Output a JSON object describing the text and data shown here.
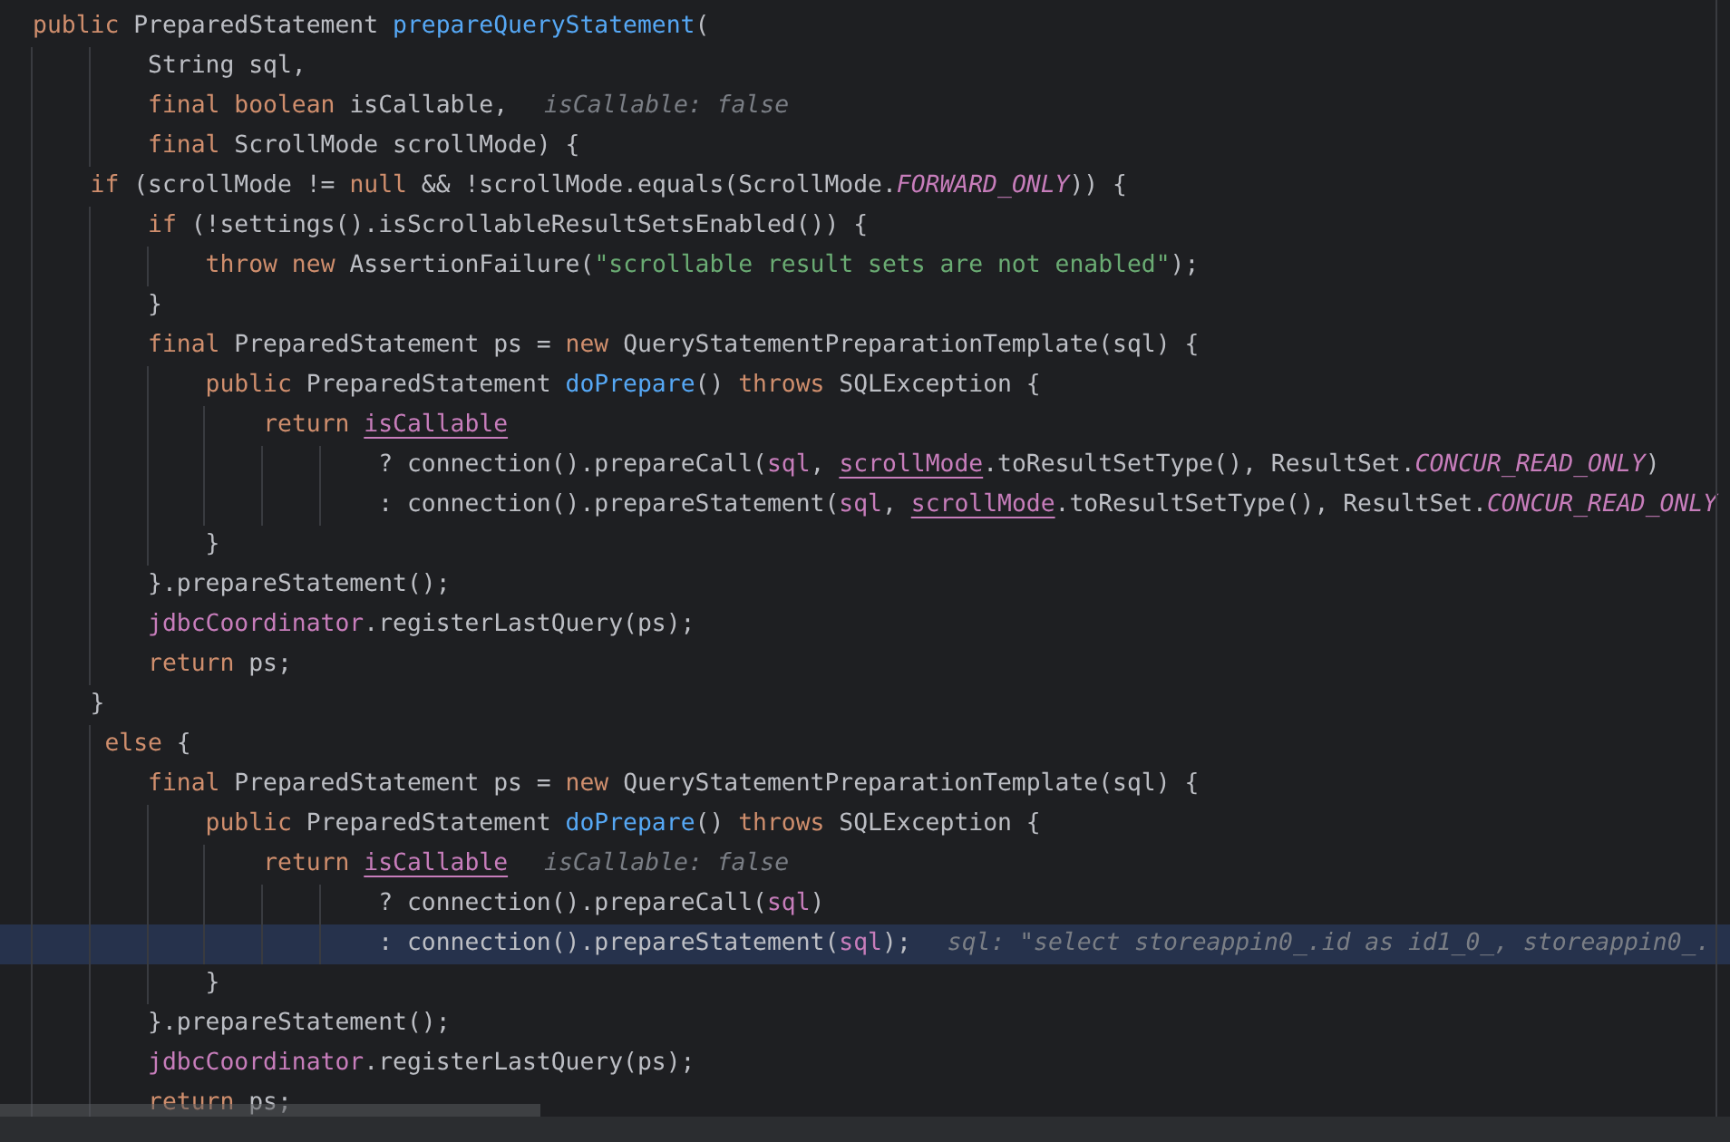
{
  "editor": {
    "lines": [
      {
        "selected": false,
        "tokens": [
          {
            "kind": "keyword",
            "text": "public"
          },
          {
            "kind": "plain",
            "text": " PreparedStatement "
          },
          {
            "kind": "method",
            "text": "prepareQueryStatement"
          },
          {
            "kind": "plain",
            "text": "("
          }
        ]
      },
      {
        "selected": false,
        "tokens": [
          {
            "kind": "plain",
            "text": "        String sql,"
          }
        ]
      },
      {
        "selected": false,
        "tokens": [
          {
            "kind": "keyword",
            "text": "        final boolean"
          },
          {
            "kind": "plain",
            "text": " isCallable,"
          }
        ],
        "hint": "isCallable: false"
      },
      {
        "selected": false,
        "tokens": [
          {
            "kind": "keyword",
            "text": "        final"
          },
          {
            "kind": "plain",
            "text": " ScrollMode scrollMode) {"
          }
        ]
      },
      {
        "selected": false,
        "tokens": [
          {
            "kind": "keyword",
            "text": "    if"
          },
          {
            "kind": "plain",
            "text": " (scrollMode != "
          },
          {
            "kind": "keyword",
            "text": "null"
          },
          {
            "kind": "plain",
            "text": " && !scrollMode.equals(ScrollMode."
          },
          {
            "kind": "constant",
            "text": "FORWARD_ONLY"
          },
          {
            "kind": "plain",
            "text": ")) {"
          }
        ]
      },
      {
        "selected": false,
        "tokens": [
          {
            "kind": "keyword",
            "text": "        if"
          },
          {
            "kind": "plain",
            "text": " (!settings().isScrollableResultSetsEnabled()) {"
          }
        ]
      },
      {
        "selected": false,
        "tokens": [
          {
            "kind": "keyword",
            "text": "            throw new"
          },
          {
            "kind": "plain",
            "text": " AssertionFailure("
          },
          {
            "kind": "string",
            "text": "\"scrollable result sets are not enabled\""
          },
          {
            "kind": "plain",
            "text": ");"
          }
        ]
      },
      {
        "selected": false,
        "tokens": [
          {
            "kind": "plain",
            "text": "        }"
          }
        ]
      },
      {
        "selected": false,
        "tokens": [
          {
            "kind": "keyword",
            "text": "        final"
          },
          {
            "kind": "plain",
            "text": " PreparedStatement ps = "
          },
          {
            "kind": "keyword",
            "text": "new"
          },
          {
            "kind": "plain",
            "text": " QueryStatementPreparationTemplate(sql) {"
          }
        ]
      },
      {
        "selected": false,
        "tokens": [
          {
            "kind": "keyword",
            "text": "            public"
          },
          {
            "kind": "plain",
            "text": " PreparedStatement "
          },
          {
            "kind": "method",
            "text": "doPrepare"
          },
          {
            "kind": "plain",
            "text": "() "
          },
          {
            "kind": "keyword",
            "text": "throws"
          },
          {
            "kind": "plain",
            "text": " SQLException {"
          }
        ]
      },
      {
        "selected": false,
        "tokens": [
          {
            "kind": "keyword",
            "text": "                return "
          },
          {
            "kind": "reassigned",
            "text": "isCallable"
          }
        ]
      },
      {
        "selected": false,
        "tokens": [
          {
            "kind": "plain",
            "text": "                        ? connection().prepareCall("
          },
          {
            "kind": "field",
            "text": "sql"
          },
          {
            "kind": "plain",
            "text": ", "
          },
          {
            "kind": "reassigned",
            "text": "scrollMode"
          },
          {
            "kind": "plain",
            "text": ".toResultSetType(), ResultSet."
          },
          {
            "kind": "constant",
            "text": "CONCUR_READ_ONLY"
          },
          {
            "kind": "plain",
            "text": ")"
          }
        ]
      },
      {
        "selected": false,
        "tokens": [
          {
            "kind": "plain",
            "text": "                        : connection().prepareStatement("
          },
          {
            "kind": "field",
            "text": "sql"
          },
          {
            "kind": "plain",
            "text": ", "
          },
          {
            "kind": "reassigned",
            "text": "scrollMode"
          },
          {
            "kind": "plain",
            "text": ".toResultSetType(), ResultSet."
          },
          {
            "kind": "constant",
            "text": "CONCUR_READ_ONLY"
          }
        ]
      },
      {
        "selected": false,
        "tokens": [
          {
            "kind": "plain",
            "text": "            }"
          }
        ]
      },
      {
        "selected": false,
        "tokens": [
          {
            "kind": "plain",
            "text": "        }.prepareStatement();"
          }
        ]
      },
      {
        "selected": false,
        "tokens": [
          {
            "kind": "field",
            "text": "        jdbcCoordinator"
          },
          {
            "kind": "plain",
            "text": ".registerLastQuery(ps);"
          }
        ]
      },
      {
        "selected": false,
        "tokens": [
          {
            "kind": "keyword",
            "text": "        return"
          },
          {
            "kind": "plain",
            "text": " ps;"
          }
        ]
      },
      {
        "selected": false,
        "tokens": [
          {
            "kind": "plain",
            "text": "    }"
          }
        ]
      },
      {
        "selected": false,
        "tokens": [
          {
            "kind": "keyword",
            "text": "     else"
          },
          {
            "kind": "plain",
            "text": " {"
          }
        ]
      },
      {
        "selected": false,
        "tokens": [
          {
            "kind": "keyword",
            "text": "        final"
          },
          {
            "kind": "plain",
            "text": " PreparedStatement ps = "
          },
          {
            "kind": "keyword",
            "text": "new"
          },
          {
            "kind": "plain",
            "text": " QueryStatementPreparationTemplate(sql) {"
          }
        ]
      },
      {
        "selected": false,
        "tokens": [
          {
            "kind": "keyword",
            "text": "            public"
          },
          {
            "kind": "plain",
            "text": " PreparedStatement "
          },
          {
            "kind": "method",
            "text": "doPrepare"
          },
          {
            "kind": "plain",
            "text": "() "
          },
          {
            "kind": "keyword",
            "text": "throws"
          },
          {
            "kind": "plain",
            "text": " SQLException {"
          }
        ]
      },
      {
        "selected": false,
        "tokens": [
          {
            "kind": "keyword",
            "text": "                return "
          },
          {
            "kind": "reassigned",
            "text": "isCallable"
          }
        ],
        "hint": "isCallable: false"
      },
      {
        "selected": false,
        "tokens": [
          {
            "kind": "plain",
            "text": "                        ? connection().prepareCall("
          },
          {
            "kind": "field",
            "text": "sql"
          },
          {
            "kind": "plain",
            "text": ")"
          }
        ]
      },
      {
        "selected": true,
        "tokens": [
          {
            "kind": "plain",
            "text": "                        : connection().prepareStatement("
          },
          {
            "kind": "field",
            "text": "sql"
          },
          {
            "kind": "plain",
            "text": ");"
          }
        ],
        "hint": "sql: \"select storeappin0_.id as id1_0_, storeappin0_."
      },
      {
        "selected": false,
        "tokens": [
          {
            "kind": "plain",
            "text": "            }"
          }
        ]
      },
      {
        "selected": false,
        "tokens": [
          {
            "kind": "plain",
            "text": "        }.prepareStatement();"
          }
        ]
      },
      {
        "selected": false,
        "tokens": [
          {
            "kind": "field",
            "text": "        jdbcCoordinator"
          },
          {
            "kind": "plain",
            "text": ".registerLastQuery(ps);"
          }
        ]
      },
      {
        "selected": false,
        "tokens": [
          {
            "kind": "keyword",
            "text": "        return"
          },
          {
            "kind": "plain",
            "text": " ps;"
          }
        ]
      }
    ]
  }
}
